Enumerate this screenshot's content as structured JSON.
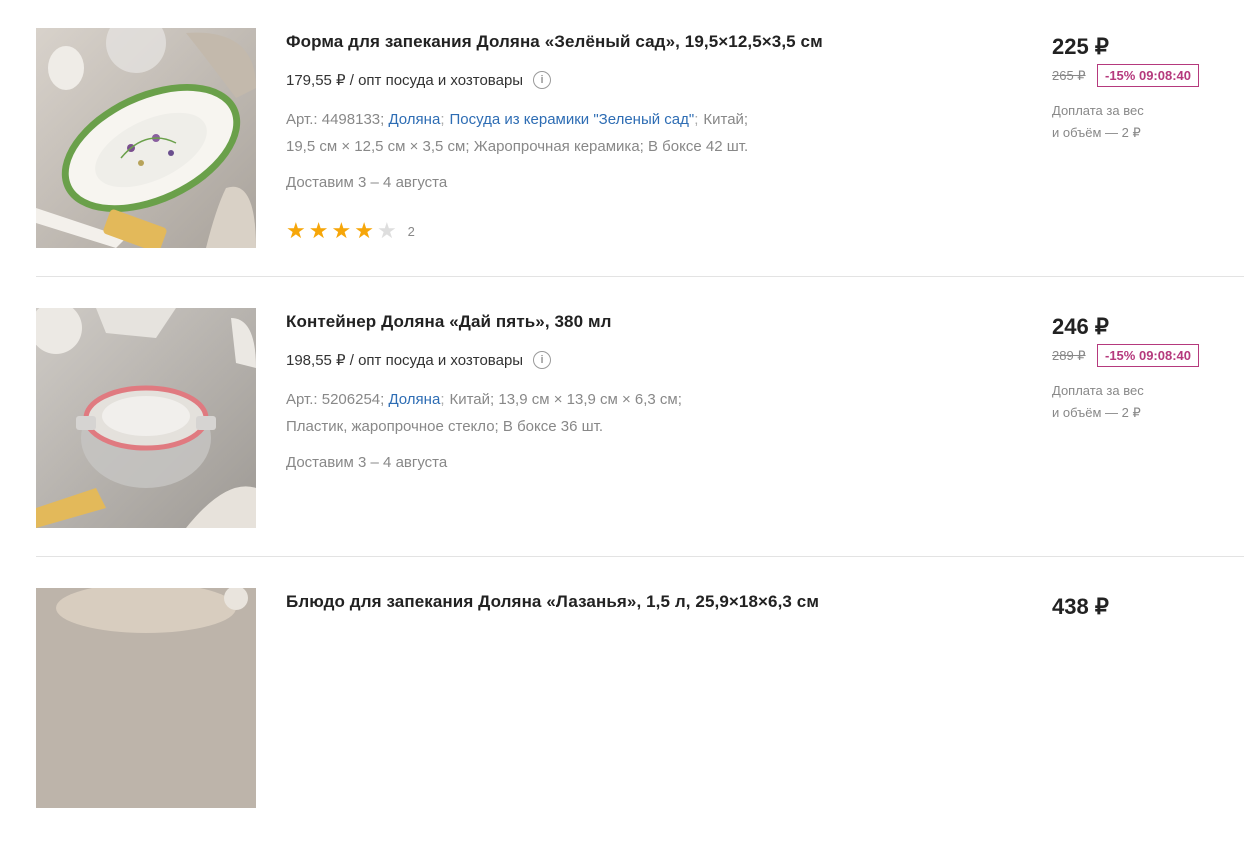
{
  "products": [
    {
      "title": "Форма для запекания Доляна «Зелёный сад», 19,5×12,5×3,5 см",
      "opt_text": "179,55 ₽ / опт посуда и хозтовары",
      "info_icon": "i",
      "art_label": "Арт.: 4498133;",
      "brand": "Доляна",
      "collection": "Посуда из керамики \"Зеленый сад\"",
      "country": "Китай;",
      "size": "19,5 см × 12,5 см × 3,5 см;",
      "material": "Жаропрочная керамика;",
      "box": "В боксе 42 шт.",
      "delivery": "Доставим 3 – 4 августа",
      "rating": 4,
      "reviews": "2",
      "price": "225 ₽",
      "old_price": "265 ₽",
      "discount": "-15% 09:08:40",
      "surcharge_line1": "Доплата за вес",
      "surcharge_line2": "и объём — 2 ₽"
    },
    {
      "title": "Контейнер Доляна «Дай пять», 380 мл",
      "opt_text": "198,55 ₽ / опт посуда и хозтовары",
      "info_icon": "i",
      "art_label": "Арт.: 5206254;",
      "brand": "Доляна",
      "country": "Китай;",
      "size": "13,9 см × 13,9 см × 6,3 см;",
      "material": "Пластик, жаропрочное стекло;",
      "box": "В боксе 36 шт.",
      "delivery": "Доставим 3 – 4 августа",
      "price": "246 ₽",
      "old_price": "289 ₽",
      "discount": "-15% 09:08:40",
      "surcharge_line1": "Доплата за вес",
      "surcharge_line2": "и объём — 2 ₽"
    },
    {
      "title": "Блюдо для запекания Доляна «Лазанья», 1,5 л, 25,9×18×6,3 см",
      "price": "438 ₽"
    }
  ],
  "colors": {
    "link": "#2e6db4",
    "discount": "#b5397d",
    "star": "#f6a609"
  }
}
